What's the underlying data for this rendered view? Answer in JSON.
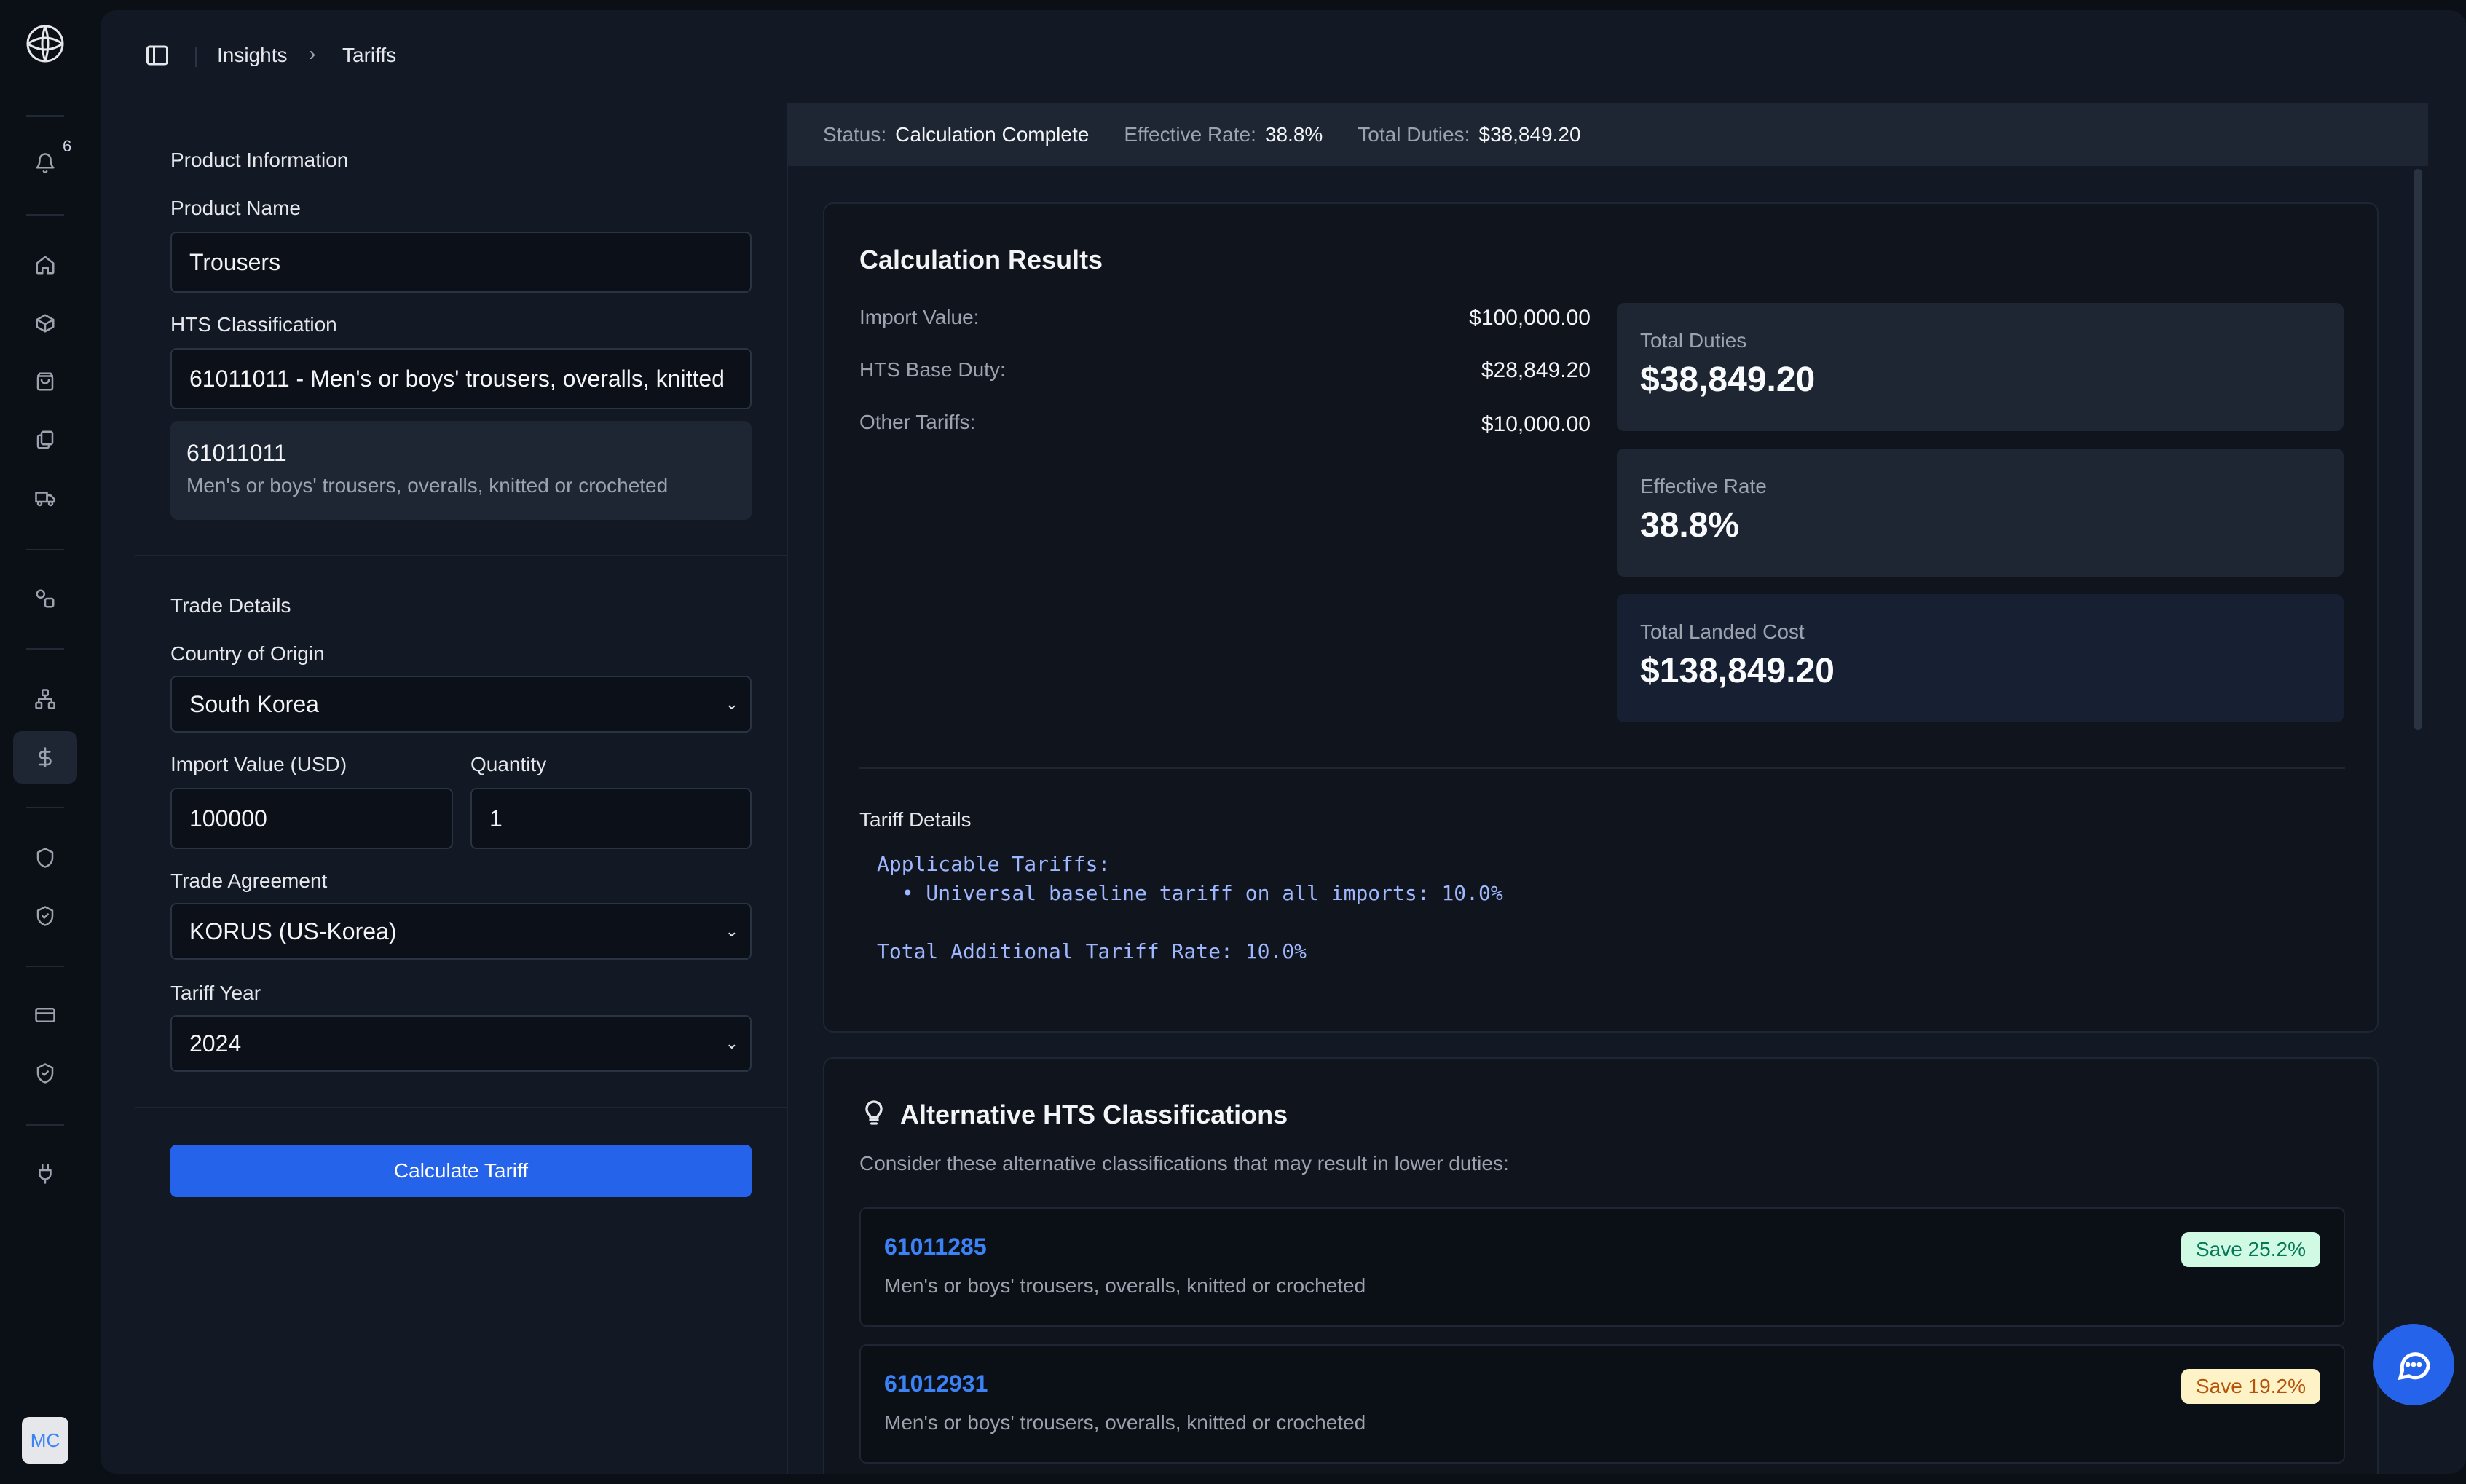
{
  "rail": {
    "notification_count": "6",
    "avatar_initials": "MC"
  },
  "breadcrumb": {
    "root": "Insights",
    "current": "Tariffs"
  },
  "form": {
    "product_info_title": "Product Information",
    "product_name_label": "Product Name",
    "product_name_value": "Trousers",
    "hts_label": "HTS Classification",
    "hts_value": "61011011 - Men's or boys' trousers, overalls, knitted",
    "suggestion": {
      "code": "61011011",
      "description": "Men's or boys' trousers, overalls, knitted or crocheted"
    },
    "trade_details_title": "Trade Details",
    "country_label": "Country of Origin",
    "country_value": "South Korea",
    "import_value_label": "Import Value (USD)",
    "import_value": "100000",
    "quantity_label": "Quantity",
    "quantity_value": "1",
    "trade_agreement_label": "Trade Agreement",
    "trade_agreement_value": "KORUS (US-Korea)",
    "tariff_year_label": "Tariff Year",
    "tariff_year_value": "2024",
    "calculate_button": "Calculate Tariff"
  },
  "status": {
    "status_key": "Status:",
    "status_value": "Calculation Complete",
    "rate_key": "Effective Rate:",
    "rate_value": "38.8%",
    "duties_key": "Total Duties:",
    "duties_value": "$38,849.20"
  },
  "results": {
    "title": "Calculation Results",
    "rows": [
      {
        "label": "Import Value:",
        "value": "$100,000.00"
      },
      {
        "label": "HTS Base Duty:",
        "value": "$28,849.20"
      },
      {
        "label": "Other Tariffs:",
        "value": "$10,000.00"
      }
    ],
    "stats": [
      {
        "label": "Total Duties",
        "value": "$38,849.20"
      },
      {
        "label": "Effective Rate",
        "value": "38.8%"
      },
      {
        "label": "Total Landed Cost",
        "value": "$138,849.20"
      }
    ],
    "tariff_details_title": "Tariff Details",
    "tariff_lines": [
      "Applicable Tariffs:",
      "  • Universal baseline tariff on all imports: 10.0%",
      "Total Additional Tariff Rate: 10.0%"
    ]
  },
  "alternatives": {
    "title": "Alternative HTS Classifications",
    "subtitle": "Consider these alternative classifications that may result in lower duties:",
    "items": [
      {
        "code": "61011285",
        "description": "Men's or boys' trousers, overalls, knitted or crocheted",
        "savings": "Save 25.2%"
      },
      {
        "code": "61012931",
        "description": "Men's or boys' trousers, overalls, knitted or crocheted",
        "savings": "Save 19.2%"
      }
    ]
  },
  "colors": {
    "accent": "#2563eb",
    "link": "#3b82f6",
    "save_green_bg": "#d1fae5",
    "save_amber_bg": "#fef3c7"
  },
  "icons": [
    "logo-icon",
    "bell-icon",
    "home-icon",
    "box-icon",
    "shopping-bag-icon",
    "documents-icon",
    "truck-icon",
    "shapes-icon",
    "network-icon",
    "dollar-icon",
    "shield-icon",
    "shield-check-icon",
    "credit-card-icon",
    "shield-check-icon",
    "plug-icon",
    "sidebar-toggle-icon",
    "lightbulb-icon",
    "chat-icon"
  ]
}
